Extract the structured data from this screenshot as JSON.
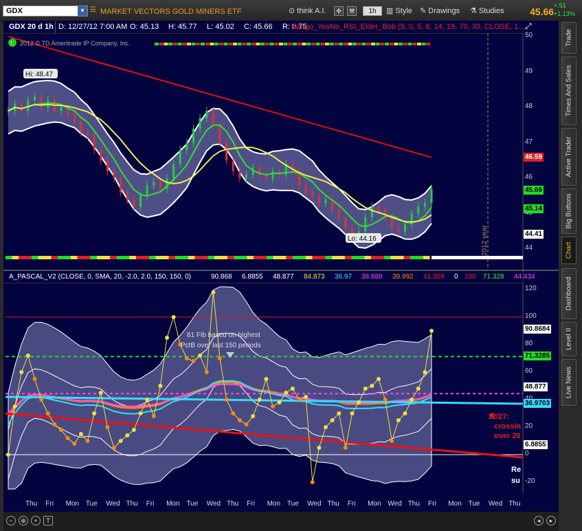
{
  "toolbar": {
    "symbol": "GDX",
    "description": "MARKET VECTORS GOLD MINERS ETF",
    "think_ai": "think A.I.",
    "interval": "1h",
    "style": "Style",
    "drawings": "Drawings",
    "studies": "Studies",
    "last_price": "45.66",
    "change": "+.51",
    "change_pct": "+1.13%"
  },
  "side_tabs": [
    "Trade",
    "Times And Sales",
    "Active Trader",
    "Big Buttons",
    "Chart",
    "Dashboard",
    "Level II",
    "Live News"
  ],
  "upper_header": {
    "chart_label": "GDX 20 d 1h",
    "date": "D: 12/27/12 7:00 AM",
    "open": "O: 45.13",
    "high": "H: 45.77",
    "low": "L: 45.02",
    "close": "C: 45.66",
    "range": "R: 0.75",
    "study": "Bongo_YesNo_RSI_Elder_Bob (9, 0, 5, 8, 14, 19, 70, 30, CLOSE, 1..."
  },
  "lower_header": {
    "study": "A_PASCAL_V2 (CLOSE, 0, SMA, 20, -2.0, 2.0, 150, 150, 0)",
    "values": [
      {
        "text": "90.868",
        "color": "#ffffff"
      },
      {
        "text": "6.8855",
        "color": "#ffffff"
      },
      {
        "text": "48.877",
        "color": "#ffffff"
      },
      {
        "text": "84.873",
        "color": "#f0e040"
      },
      {
        "text": "36.97",
        "color": "#33ddff"
      },
      {
        "text": "38.888",
        "color": "#ff44ff"
      },
      {
        "text": "39.992",
        "color": "#ff8800"
      },
      {
        "text": "41.369",
        "color": "#ee2222"
      },
      {
        "text": "0",
        "color": "#ffffff"
      },
      {
        "text": "100",
        "color": "#ee2222"
      },
      {
        "text": "71.328",
        "color": "#33ee33"
      },
      {
        "text": "44.434",
        "color": "#ff44ff"
      }
    ]
  },
  "annotations": {
    "copyright": "2012 © TD Ameritrade IP Company, Inc.",
    "hi_label": "Hi: 48.47",
    "lo_label": "Lo: 44.16",
    "year_label": "2012 year",
    "fib_note_1": "61 Fib based on highest",
    "fib_note_2": "PctB over last 150 periods",
    "crossing_1": "12/27:",
    "crossing_2": "crossin",
    "crossing_3": "over 20",
    "right_text_1": "Re",
    "right_text_2": "su"
  },
  "chart_data": [
    {
      "type": "line",
      "name": "upper",
      "y_ticks": [
        44,
        45,
        46,
        47,
        48,
        49,
        50
      ],
      "ylim": [
        43.5,
        50.1
      ],
      "price_labels": [
        {
          "text": "46.59",
          "value": 46.59,
          "bg": "#e02020",
          "fg": "#ffffff"
        },
        {
          "text": "45.66",
          "value": 45.66,
          "bg": "#22dd22",
          "fg": "#000000"
        },
        {
          "text": "45.14",
          "value": 45.14,
          "bg": "#22dd22",
          "fg": "#000000"
        },
        {
          "text": "44.41",
          "value": 44.41,
          "bg": "#ffffff",
          "fg": "#000000"
        }
      ],
      "high": 48.47,
      "low": 44.16,
      "close_series": [
        47.9,
        48.1,
        47.9,
        48.2,
        48.3,
        48.0,
        48.2,
        47.9,
        48.0,
        47.8,
        47.6,
        47.3,
        47.2,
        46.8,
        46.5,
        46.2,
        46.0,
        45.6,
        45.4,
        45.2,
        45.5,
        45.8,
        45.9,
        45.7,
        46.0,
        46.4,
        46.8,
        47.0,
        47.4,
        47.7,
        47.9,
        47.5,
        47.0,
        46.5,
        46.2,
        46.0,
        46.1,
        46.3,
        46.1,
        46.0,
        46.2,
        46.1,
        46.4,
        46.2,
        45.8,
        45.6,
        45.5,
        45.3,
        45.4,
        45.1,
        44.9,
        44.6,
        44.3,
        44.5,
        44.9,
        45.2,
        45.1,
        44.9,
        44.6,
        44.5,
        44.7,
        45.0,
        45.2,
        45.3,
        45.7
      ],
      "resistance_line": {
        "start": 50.0,
        "end": 46.59
      }
    },
    {
      "type": "line",
      "name": "lower",
      "y_ticks": [
        -20,
        0,
        20,
        40,
        60,
        80,
        100,
        120
      ],
      "ylim": [
        -28,
        125
      ],
      "price_labels": [
        {
          "text": "90.8684",
          "value": 90.8684,
          "bg": "#ffffff",
          "fg": "#000000"
        },
        {
          "text": "71.3285",
          "value": 71.3285,
          "bg": "#22dd22",
          "fg": "#000000"
        },
        {
          "text": "48.877",
          "value": 48.877,
          "bg": "#ffffff",
          "fg": "#000000"
        },
        {
          "text": "36.9703",
          "value": 36.9703,
          "bg": "#33ddff",
          "fg": "#000000"
        },
        {
          "text": "6.8855",
          "value": 6.8855,
          "bg": "#ffffff",
          "fg": "#000000"
        }
      ],
      "pctb_series": [
        0,
        35,
        60,
        72,
        55,
        40,
        30,
        22,
        18,
        12,
        8,
        15,
        10,
        30,
        45,
        20,
        5,
        10,
        14,
        18,
        30,
        40,
        28,
        50,
        85,
        100,
        80,
        70,
        68,
        72,
        60,
        118,
        70,
        40,
        30,
        25,
        22,
        28,
        40,
        55,
        35,
        38,
        45,
        48,
        40,
        42,
        -20,
        5,
        20,
        25,
        30,
        5,
        30,
        38,
        48,
        50,
        55,
        40,
        10,
        25,
        30,
        40,
        48,
        60,
        90
      ],
      "fib_level": 71.3285,
      "upper_level": 100,
      "zero_level": 0
    }
  ],
  "x_labels": [
    "Thu",
    "Fri",
    "Mon",
    "Tue",
    "Wed",
    "Thu",
    "Fri",
    "Mon",
    "Tue",
    "Wed",
    "Thu",
    "Fri",
    "Mon",
    "Tue",
    "Wed",
    "Thu",
    "Fri",
    "Mon",
    "Wed",
    "Thu",
    "Fri",
    "Mon",
    "Tue",
    "Wed",
    "Thu"
  ]
}
